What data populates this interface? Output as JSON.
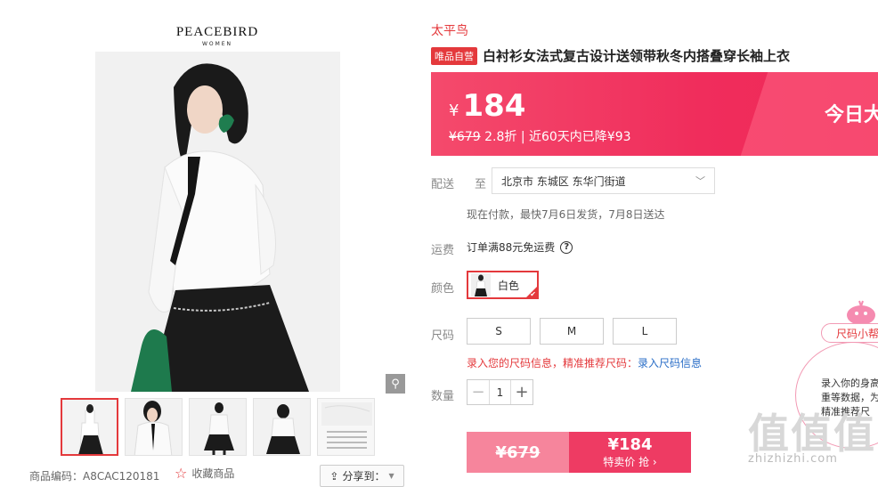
{
  "brand": {
    "line1": "PEACEBIRD",
    "line2": "WOMEN"
  },
  "gallery": {
    "zoom_icon": "magnifier-icon",
    "thumb_count": 5
  },
  "footer": {
    "sku_label": "商品编码：",
    "sku_value": "A8CAC120181",
    "favorite_label": "收藏商品",
    "share_label": "分享到："
  },
  "product": {
    "shop_name": "太平鸟",
    "tag": "唯品自营",
    "title": "白衬衫女法式复古设计送领带秋冬内搭叠穿长袖上衣"
  },
  "price": {
    "currency": "¥",
    "value": "184",
    "original": "¥679",
    "discount": "2.8折",
    "history": "| 近60天内已降¥93",
    "today_tag": "今日大"
  },
  "delivery": {
    "label": "配送",
    "to": "至",
    "address": "北京市 东城区 东华门街道",
    "note": "现在付款，最快7月6日发货，7月8日送达"
  },
  "shipping": {
    "label": "运费",
    "text": "订单满88元免运费",
    "help": "?"
  },
  "color": {
    "label": "颜色",
    "selected": "白色"
  },
  "size": {
    "label": "尺码",
    "options": [
      "S",
      "M",
      "L"
    ],
    "tip_prefix": "录入您的尺码信息，精准推荐尺码：",
    "tip_link": "录入尺码信息"
  },
  "quantity": {
    "label": "数量",
    "value": "1",
    "minus": "−",
    "plus": "+"
  },
  "buy": {
    "orig_price": "¥679",
    "price": "¥184",
    "action": "特卖价 抢 ›"
  },
  "assistant": {
    "pill": "尺码小帮",
    "bubble_lines": [
      "录入你的身高",
      "重等数据，为",
      "精准推荐尺"
    ]
  },
  "watermark": {
    "big": "值值值",
    "small": "zhizhizhi.com"
  }
}
